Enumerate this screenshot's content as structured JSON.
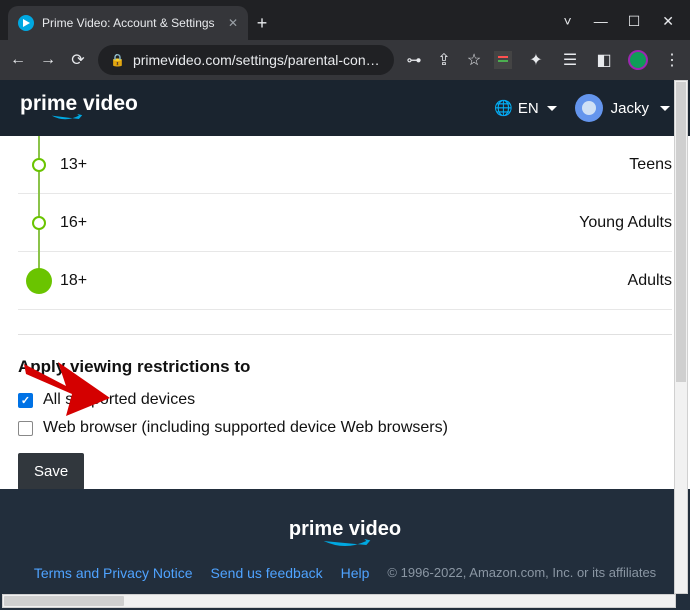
{
  "browser": {
    "tab_title": "Prime Video: Account & Settings",
    "url_display": "primevideo.com/settings/parental-cont…"
  },
  "header": {
    "logo_text": "prime video",
    "lang": "EN",
    "user": "Jacky"
  },
  "ratings": [
    {
      "age": "13+",
      "audience": "Teens"
    },
    {
      "age": "16+",
      "audience": "Young Adults"
    },
    {
      "age": "18+",
      "audience": "Adults"
    }
  ],
  "restrictions": {
    "title": "Apply viewing restrictions to",
    "all_devices_label": "All supported devices",
    "all_devices_checked": true,
    "web_browser_label": "Web browser (including supported device Web browsers)",
    "web_browser_checked": false,
    "save_label": "Save"
  },
  "footer": {
    "logo_text": "prime video",
    "links": {
      "terms": "Terms and Privacy Notice",
      "feedback": "Send us feedback",
      "help": "Help"
    },
    "copyright": "© 1996-2022, Amazon.com, Inc. or its affiliates"
  }
}
